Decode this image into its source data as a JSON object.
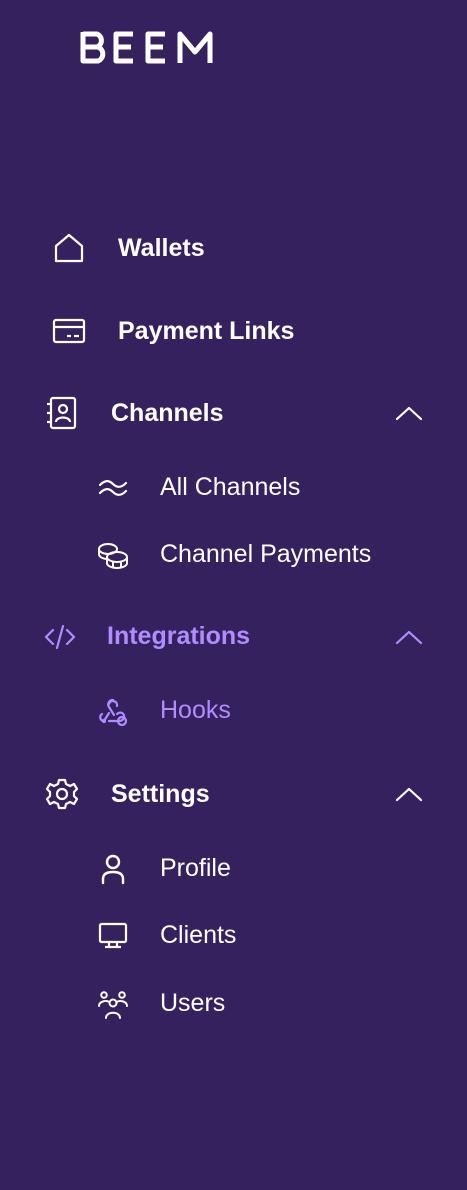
{
  "brand": {
    "logo_text": "BEEM"
  },
  "colors": {
    "background": "#36215f",
    "text": "#ffffff",
    "active": "#b18cff"
  },
  "nav": {
    "wallets": {
      "label": "Wallets",
      "icon": "home-icon"
    },
    "payment_links": {
      "label": "Payment Links",
      "icon": "card-icon"
    },
    "channels": {
      "label": "Channels",
      "icon": "contact-book-icon",
      "expanded": true,
      "items": [
        {
          "label": "All Channels",
          "icon": "waves-icon"
        },
        {
          "label": "Channel Payments",
          "icon": "coins-icon"
        }
      ]
    },
    "integrations": {
      "label": "Integrations",
      "icon": "code-icon",
      "expanded": true,
      "active": true,
      "items": [
        {
          "label": "Hooks",
          "icon": "webhook-icon",
          "active": true
        }
      ]
    },
    "settings": {
      "label": "Settings",
      "icon": "gear-icon",
      "expanded": true,
      "items": [
        {
          "label": "Profile",
          "icon": "user-icon"
        },
        {
          "label": "Clients",
          "icon": "monitor-icon"
        },
        {
          "label": "Users",
          "icon": "users-icon"
        }
      ]
    }
  }
}
